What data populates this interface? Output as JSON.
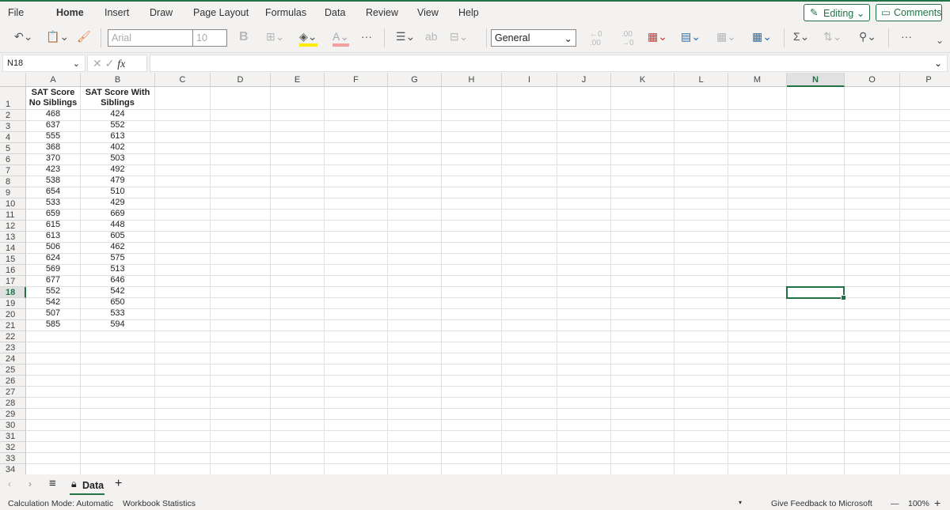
{
  "menu": [
    "File",
    "Home",
    "Insert",
    "Draw",
    "Page Layout",
    "Formulas",
    "Data",
    "Review",
    "View",
    "Help"
  ],
  "active_menu": "Home",
  "editing_label": "Editing",
  "comments_label": "Comments",
  "toolbar": {
    "font_name": "Arial",
    "font_size": "10",
    "bold": "B",
    "number_format": "General"
  },
  "name_box": "N18",
  "fx": "fx",
  "columns": [
    "A",
    "B",
    "C",
    "D",
    "E",
    "F",
    "G",
    "H",
    "I",
    "J",
    "K",
    "L",
    "M",
    "N",
    "O",
    "P"
  ],
  "selected_cell": {
    "col": "N",
    "row": 18
  },
  "headers": [
    [
      "SAT Score",
      "No Siblings"
    ],
    [
      "SAT Score With",
      "Siblings"
    ]
  ],
  "rows": [
    [
      "468",
      "424"
    ],
    [
      "637",
      "552"
    ],
    [
      "555",
      "613"
    ],
    [
      "368",
      "402"
    ],
    [
      "370",
      "503"
    ],
    [
      "423",
      "492"
    ],
    [
      "538",
      "479"
    ],
    [
      "654",
      "510"
    ],
    [
      "533",
      "429"
    ],
    [
      "659",
      "669"
    ],
    [
      "615",
      "448"
    ],
    [
      "613",
      "605"
    ],
    [
      "506",
      "462"
    ],
    [
      "624",
      "575"
    ],
    [
      "569",
      "513"
    ],
    [
      "677",
      "646"
    ],
    [
      "552",
      "542"
    ],
    [
      "542",
      "650"
    ],
    [
      "507",
      "533"
    ],
    [
      "585",
      "594"
    ]
  ],
  "sheet_tab": "Data",
  "status": {
    "calc_mode": "Calculation Mode: Automatic",
    "stats": "Workbook Statistics",
    "feedback": "Give Feedback to Microsoft",
    "zoom": "100%"
  },
  "accent": "#217346"
}
